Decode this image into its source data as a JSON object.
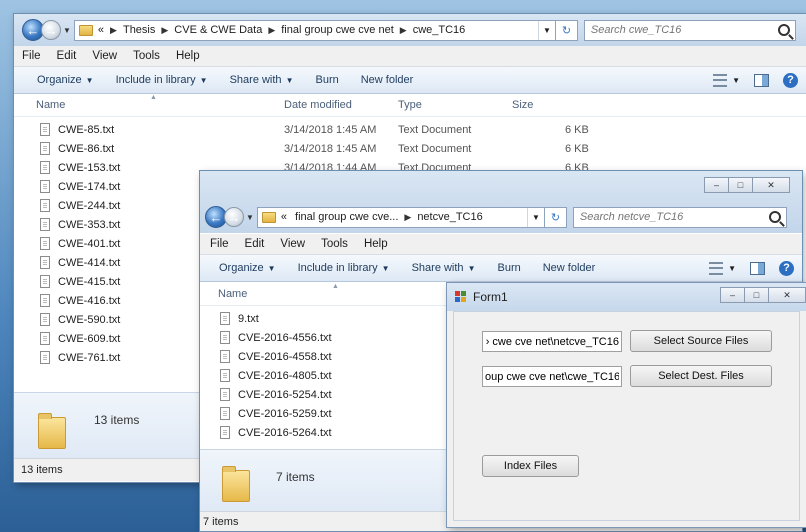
{
  "back_window": {
    "breadcrumb": [
      "«",
      "Thesis",
      "CVE & CWE Data",
      "final group cwe cve net",
      "cwe_TC16"
    ],
    "search_placeholder": "Search cwe_TC16",
    "menu": [
      "File",
      "Edit",
      "View",
      "Tools",
      "Help"
    ],
    "commands": [
      {
        "label": "Organize",
        "dropdown": true
      },
      {
        "label": "Include in library",
        "dropdown": true
      },
      {
        "label": "Share with",
        "dropdown": true
      },
      {
        "label": "Burn",
        "dropdown": false
      },
      {
        "label": "New folder",
        "dropdown": false
      }
    ],
    "columns": {
      "name": "Name",
      "date": "Date modified",
      "type": "Type",
      "size": "Size"
    },
    "files": [
      {
        "name": "CWE-85.txt",
        "date": "3/14/2018 1:45 AM",
        "type": "Text Document",
        "size": "6 KB"
      },
      {
        "name": "CWE-86.txt",
        "date": "3/14/2018 1:45 AM",
        "type": "Text Document",
        "size": "6 KB"
      },
      {
        "name": "CWE-153.txt",
        "date": "3/14/2018 1:44 AM",
        "type": "Text Document",
        "size": "6 KB"
      },
      {
        "name": "CWE-174.txt"
      },
      {
        "name": "CWE-244.txt"
      },
      {
        "name": "CWE-353.txt"
      },
      {
        "name": "CWE-401.txt"
      },
      {
        "name": "CWE-414.txt"
      },
      {
        "name": "CWE-415.txt"
      },
      {
        "name": "CWE-416.txt"
      },
      {
        "name": "CWE-590.txt"
      },
      {
        "name": "CWE-609.txt"
      },
      {
        "name": "CWE-761.txt"
      }
    ],
    "details_count": "13 items",
    "status": "13 items"
  },
  "front_window": {
    "breadcrumb": [
      "«",
      "final group cwe cve...",
      "netcve_TC16"
    ],
    "search_placeholder": "Search netcve_TC16",
    "menu": [
      "File",
      "Edit",
      "View",
      "Tools",
      "Help"
    ],
    "commands": [
      {
        "label": "Organize",
        "dropdown": true
      },
      {
        "label": "Include in library",
        "dropdown": true
      },
      {
        "label": "Share with",
        "dropdown": true
      },
      {
        "label": "Burn",
        "dropdown": false
      },
      {
        "label": "New folder",
        "dropdown": false
      }
    ],
    "columns": {
      "name": "Name"
    },
    "files": [
      {
        "name": "9.txt"
      },
      {
        "name": "CVE-2016-4556.txt"
      },
      {
        "name": "CVE-2016-4558.txt"
      },
      {
        "name": "CVE-2016-4805.txt"
      },
      {
        "name": "CVE-2016-5254.txt"
      },
      {
        "name": "CVE-2016-5259.txt"
      },
      {
        "name": "CVE-2016-5264.txt"
      }
    ],
    "details_count": "7 items",
    "status": "7 items"
  },
  "form": {
    "title": "Form1",
    "source_path": "› cwe cve net\\netcve_TC16",
    "dest_path": "oup cwe cve net\\cwe_TC16",
    "select_source_label": "Select Source Files",
    "select_dest_label": "Select Dest. Files",
    "index_label": "Index Files"
  },
  "icons": {
    "back": "back-arrow-icon",
    "forward": "forward-arrow-icon",
    "refresh": "refresh-icon",
    "search": "search-icon",
    "folder": "folder-icon",
    "text_file": "text-file-icon",
    "minimize": "minimize-icon",
    "maximize": "maximize-icon",
    "close": "close-icon",
    "help": "help-icon"
  },
  "colors": {
    "accent": "#3a78c2",
    "desktop": "#4d86bd",
    "command_bar": "#dde8f5"
  }
}
